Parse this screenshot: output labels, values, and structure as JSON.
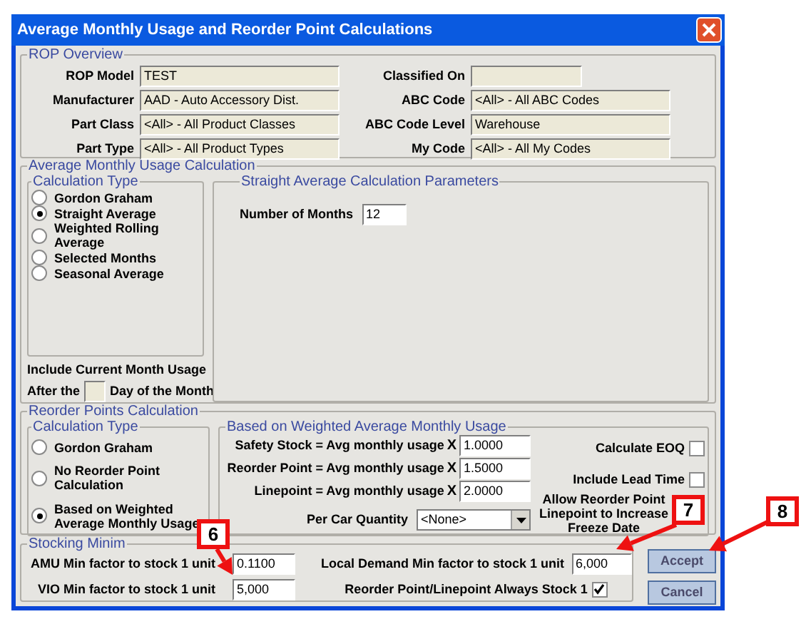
{
  "window": {
    "title": "Average Monthly Usage and Reorder Point Calculations"
  },
  "rop_overview": {
    "title": "ROP Overview",
    "left_fields": [
      {
        "label": "ROP Model",
        "value": "TEST"
      },
      {
        "label": "Manufacturer",
        "value": "AAD - Auto Accessory Dist."
      },
      {
        "label": "Part Class",
        "value": "<All> - All Product Classes"
      },
      {
        "label": "Part Type",
        "value": "<All> - All Product Types"
      }
    ],
    "right_fields": [
      {
        "label": "Classified On"
      },
      {
        "label": "ABC Code",
        "value": "<All> - All ABC Codes"
      },
      {
        "label": "ABC Code Level",
        "value": "Warehouse"
      },
      {
        "label": "My Code",
        "value": "<All> - All My Codes"
      }
    ]
  },
  "amu_calculation": {
    "title": "Average Monthly Usage Calculation",
    "calculation_type": {
      "title": "Calculation Type",
      "options": [
        {
          "label": "Gordon Graham",
          "selected": false
        },
        {
          "label": "Straight Average",
          "selected": true
        },
        {
          "label": "Weighted Rolling Average",
          "selected": false
        },
        {
          "label": "Selected Months",
          "selected": false
        },
        {
          "label": "Seasonal Average",
          "selected": false
        }
      ]
    },
    "include_current_month": "Include Current Month Usage",
    "after_the": "After the",
    "day_of_month": "Day of the Month",
    "parameters": {
      "title": "Straight Average Calculation Parameters",
      "label": "Number of Months",
      "value": "12"
    }
  },
  "reorder_points": {
    "title": "Reorder Points Calculation",
    "calculation_type": {
      "title": "Calculation Type",
      "options": [
        {
          "label": "Gordon Graham",
          "selected": false
        },
        {
          "label": "No Reorder Point Calculation",
          "selected": false
        },
        {
          "label": "Based on Weighted Average Monthly Usage",
          "selected": true
        }
      ]
    },
    "weighted": {
      "title": "Based on Weighted Average Monthly Usage",
      "factors": [
        {
          "label": "Safety Stock = Avg monthly usage",
          "operator": "X",
          "value": "1.0000"
        },
        {
          "label": "Reorder Point = Avg monthly usage",
          "operator": "X",
          "value": "1.5000"
        },
        {
          "label": "Linepoint = Avg monthly usage",
          "operator": "X",
          "value": "2.0000"
        }
      ],
      "per_car": {
        "label": "Per Car Quantity",
        "value": "<None>"
      },
      "options": [
        {
          "label": "Calculate EOQ",
          "checked": false
        },
        {
          "label": "Include Lead Time",
          "checked": false
        }
      ],
      "allow_lines": [
        "Allow Reorder Point",
        "Linepoint to Increase",
        "Freeze Date"
      ]
    }
  },
  "stocking_minimums": {
    "title": "Stocking Minim",
    "amu": {
      "label": "AMU Min factor to stock 1 unit",
      "value": "0.1100"
    },
    "vio": {
      "label": "VIO Min factor to stock 1 unit",
      "value": "5,000"
    },
    "local_demand": {
      "label": "Local Demand Min factor to stock 1 unit",
      "value": "6,000"
    },
    "always_stock": {
      "label": "Reorder Point/Linepoint Always Stock 1",
      "checked": true
    }
  },
  "buttons": [
    {
      "label": "Accept"
    },
    {
      "label": "Cancel"
    }
  ],
  "callouts": [
    "6",
    "7",
    "8"
  ]
}
